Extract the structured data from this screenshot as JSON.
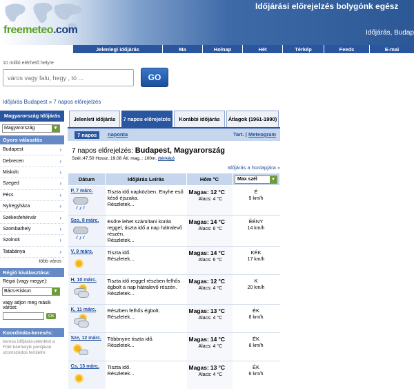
{
  "header": {
    "logo_a": "free",
    "logo_b": "meteo",
    "logo_c": ".com",
    "slogan": "Időjárási előrejelzés bolygónk egész",
    "sub_slogan": "Időjárás, Budap"
  },
  "nav": [
    "Jelenlegi időjárás",
    "Ma",
    "Holnap",
    "Hét",
    "Térkép",
    "Feeds",
    "E-mai"
  ],
  "search": {
    "hint": "10 millió elérhető helyre",
    "placeholder": "város vagy falu, hegy , tó ...",
    "button": "GO"
  },
  "breadcrumb": "Időjárás Budapest » 7 napos előrejelzés",
  "sidebar": {
    "country_head": "Magyarország Időjárás",
    "country_select": "Magyarország",
    "quick_head": "Gyors választás",
    "cities": [
      "Budapest",
      "Debrecen",
      "Miskolc",
      "Szeged",
      "Pécs",
      "Nyíregyháza",
      "Székesfehérvár",
      "Szombathely",
      "Szolnok",
      "Tatabánya"
    ],
    "more": "több város",
    "region_head": "Régió kiválasztása:",
    "region_label": "Régió (vagy megye):",
    "region_select": "Bács-Kiskun",
    "other_label": "vagy adjon meg másik várost:",
    "ok": "Ok",
    "coord_head": "Koordináta-keresés:",
    "coord_note": "keress időjárás-jelentést a Föld bármelyik pontjával szomszédos területre"
  },
  "tabs": [
    "Jelenleti időjárás",
    "7 napos előrejelzés",
    "Korábbi időjárás",
    "Átlagok (1961-1990)"
  ],
  "subtabs": {
    "active": "7 napos",
    "other": "naponta",
    "tart": "Tart.",
    "sep": "|",
    "meteogram": "Meteogram"
  },
  "title": {
    "prefix": "7 napos előrejelzés:",
    "place": "Budapest, Magyarország"
  },
  "coord": {
    "text": "Szél.:47.50 Hossz.:19.08 Átl. mag..: 100m.",
    "link": "(térkép)"
  },
  "homepage_link": "Időjárás a honlapjára »",
  "table": {
    "headers": [
      "Dátum",
      "Időjárás Leírás",
      "Hőm °C",
      "Max szél"
    ],
    "rows": [
      {
        "day": "P, 7 márc.",
        "icon": "cloud-rain-icon",
        "desc": "Tiszta idő napközben. Enyhe eső késő éjszaka.",
        "more": "Részletek...",
        "hi_label": "Magas:",
        "hi": "12",
        "lo_label": "Alacs:",
        "lo": "4",
        "unit": "°C",
        "wind_dir": "É",
        "wind": "9 km/h"
      },
      {
        "day": "Szo, 8 márc.",
        "icon": "cloud-rain-icon",
        "desc": "Esőre lehet számítani korán reggel, tiszta idő a nap hátralevő részén.",
        "more": "Részletek...",
        "hi_label": "Magas:",
        "hi": "14",
        "lo_label": "Alacs:",
        "lo": "6",
        "unit": "°C",
        "wind_dir": "ÉÉNY",
        "wind": "14 km/h"
      },
      {
        "day": "V, 9 márc.",
        "icon": "sun-icon",
        "desc": "Tiszta idő.",
        "more": "Részletek...",
        "hi_label": "Magas:",
        "hi": "14",
        "lo_label": "Alacs:",
        "lo": "6",
        "unit": "°C",
        "wind_dir": "KÉK",
        "wind": "17 km/h"
      },
      {
        "day": "H, 10 márc.",
        "icon": "partly-cloudy-icon",
        "desc": "Tiszta idő reggel részben felhős égbolt a nap hátralevő részén.",
        "more": "Részletek...",
        "hi_label": "Magas:",
        "hi": "12",
        "lo_label": "Alacs:",
        "lo": "4",
        "unit": "°C",
        "wind_dir": "K",
        "wind": "20 km/h"
      },
      {
        "day": "K, 11 márc.",
        "icon": "partly-cloudy-icon",
        "desc": "Részben felhős égbolt.",
        "more": "Részletek...",
        "hi_label": "Magas:",
        "hi": "13",
        "lo_label": "Alacs:",
        "lo": "4",
        "unit": "°C",
        "wind_dir": "ÉK",
        "wind": "8 km/h"
      },
      {
        "day": "Sze, 12 márc.",
        "icon": "sun-small-cloud-icon",
        "desc": "Többnyire tiszta idő.",
        "more": "Részletek...",
        "hi_label": "Magas:",
        "hi": "14",
        "lo_label": "Alacs:",
        "lo": "4",
        "unit": "°C",
        "wind_dir": "ÉK",
        "wind": "8 km/h"
      },
      {
        "day": "Cs, 13 márc.",
        "icon": "sun-icon",
        "desc": "Tiszta idő.",
        "more": "Részletek...",
        "hi_label": "Magas:",
        "hi": "13",
        "lo_label": "Alacs:",
        "lo": "4",
        "unit": "°C",
        "wind_dir": "ÉK",
        "wind": "6 km/h"
      }
    ]
  },
  "colors": {
    "brand_blue": "#2a56a0",
    "brand_green": "#5aa01e",
    "link": "#1f4d9c"
  }
}
